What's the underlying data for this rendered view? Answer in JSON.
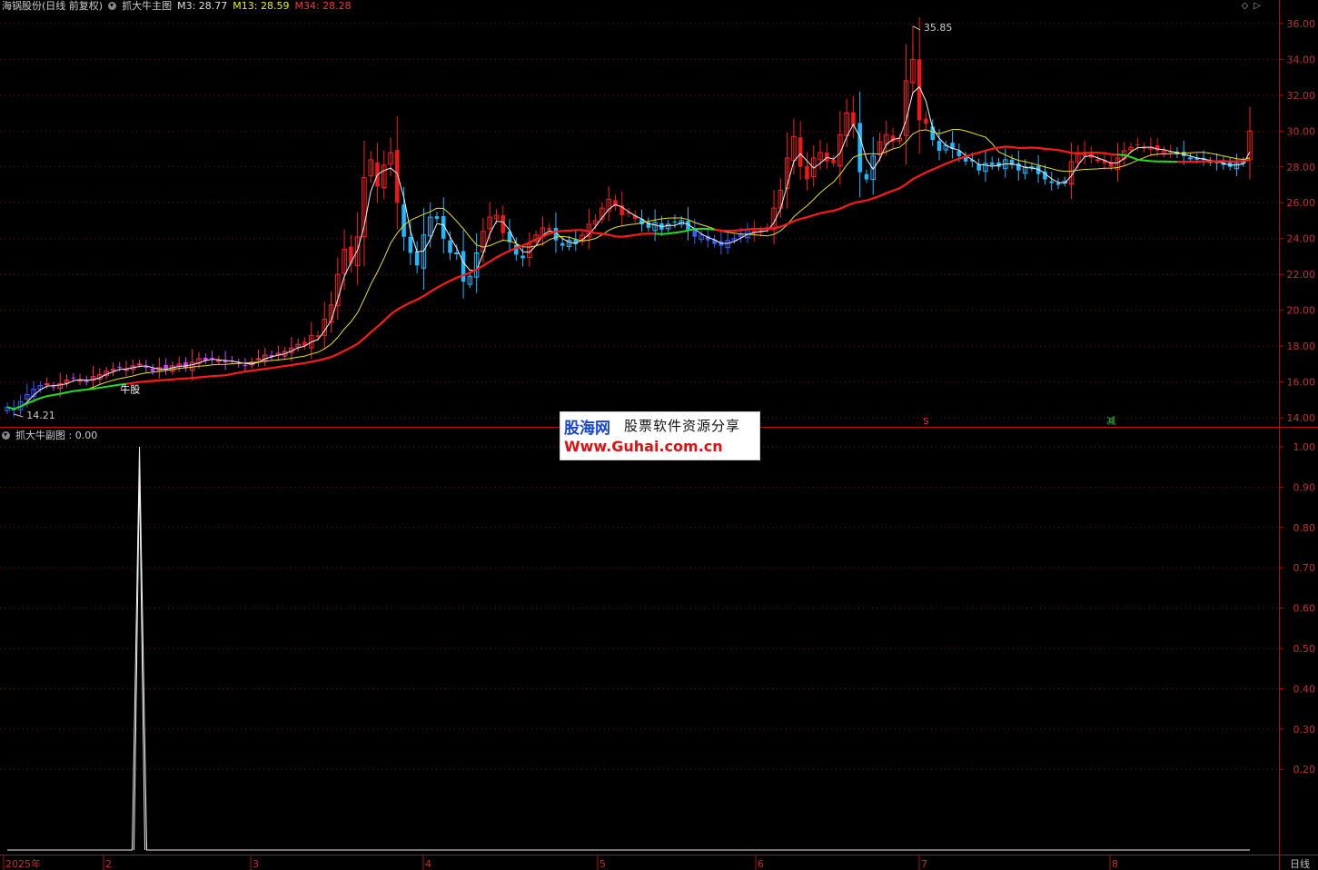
{
  "header": {
    "stock": "海锅股份(日线 前复权)",
    "indicator": "抓大牛主图",
    "ma": [
      {
        "label": "M3: 28.77",
        "color": "#e0e0e0"
      },
      {
        "label": "M13: 28.59",
        "color": "#f0f000"
      },
      {
        "label": "M34: 28.28",
        "color": "#ff3030"
      }
    ]
  },
  "sub_header": {
    "label": "抓大牛副图 : 0.00"
  },
  "watermark": {
    "logo": "股海网",
    "tagline": "股票软件资源分享",
    "url": "Www.Guhai.com.cn"
  },
  "bottom_right_label": "日线",
  "markers": {
    "signal_buy": "牛股",
    "s_mark": "S",
    "reduce_mark": "减"
  },
  "chart_data": [
    {
      "type": "candlestick",
      "ylim": [
        13.5,
        36.6
      ],
      "y_ticks": [
        "14.00",
        "16.00",
        "18.00",
        "20.00",
        "22.00",
        "24.00",
        "26.00",
        "28.00",
        "30.00",
        "32.00",
        "34.00",
        "36.00"
      ],
      "x_labels": [
        "2025年",
        "2",
        "3",
        "4",
        "5",
        "6",
        "7",
        "8"
      ],
      "high_annotation": "35.85",
      "low_annotation": "14.21",
      "close": [
        14.6,
        14.4,
        14.9,
        15.3,
        15.6,
        15.8,
        15.9,
        15.7,
        15.9,
        16.1,
        16.2,
        16.1,
        16.0,
        16.3,
        16.4,
        16.6,
        16.7,
        16.8,
        16.7,
        16.9,
        17.0,
        16.8,
        16.6,
        16.8,
        16.7,
        16.9,
        17.0,
        16.8,
        17.1,
        17.3,
        17.2,
        17.3,
        17.2,
        17.1,
        17.2,
        17.0,
        16.9,
        17.1,
        17.3,
        17.5,
        17.4,
        17.6,
        17.7,
        17.9,
        18.1,
        18.0,
        18.6,
        18.5,
        19.5,
        20.3,
        22.0,
        23.4,
        22.6,
        24.1,
        27.4,
        28.4,
        26.9,
        28.1,
        28.8,
        26.0,
        24.1,
        23.2,
        22.5,
        24.2,
        25.2,
        25.1,
        24.0,
        23.2,
        23.2,
        21.6,
        21.9,
        23.2,
        24.4,
        25.2,
        25.3,
        24.3,
        23.8,
        23.1,
        22.9,
        23.7,
        24.2,
        24.6,
        24.5,
        23.9,
        23.6,
        23.9,
        23.7,
        24.2,
        24.8,
        25.0,
        25.7,
        26.2,
        25.8,
        25.3,
        25.4,
        25.1,
        24.8,
        24.6,
        24.9,
        24.5,
        24.8,
        24.9,
        25.0,
        24.5,
        24.1,
        24.2,
        23.9,
        23.7,
        23.6,
        23.9,
        24.0,
        24.2,
        24.5,
        24.3,
        24.4,
        24.6,
        25.7,
        26.7,
        28.5,
        29.7,
        28.0,
        27.3,
        28.5,
        28.8,
        28.3,
        28.2,
        29.8,
        31.0,
        30.3,
        27.7,
        27.3,
        28.6,
        29.4,
        29.8,
        29.4,
        29.6,
        32.8,
        34.0,
        30.6,
        30.4,
        29.5,
        28.9,
        29.2,
        29.0,
        28.6,
        28.3,
        28.3,
        27.8,
        28.2,
        28.1,
        28.0,
        28.4,
        28.1,
        27.8,
        28.0,
        28.0,
        27.6,
        27.3,
        27.1,
        27.0,
        27.2,
        28.3,
        28.8,
        28.6,
        28.5,
        28.4,
        28.2,
        28.0,
        28.5,
        28.9,
        29.1,
        29.2,
        29.0,
        29.1,
        28.9,
        28.9,
        28.8,
        28.7,
        28.6,
        28.5,
        28.4,
        28.4,
        28.3,
        28.2,
        28.1,
        28.0,
        28.2,
        28.3,
        30.0
      ]
    },
    {
      "type": "line",
      "ylim": [
        0,
        1.0
      ],
      "y_ticks": [
        "0.20",
        "0.30",
        "0.40",
        "0.50",
        "0.60",
        "0.70",
        "0.80",
        "0.90",
        "1.00"
      ],
      "spike_index": 20,
      "values_baseline": 0,
      "spike_value": 1.0
    }
  ]
}
